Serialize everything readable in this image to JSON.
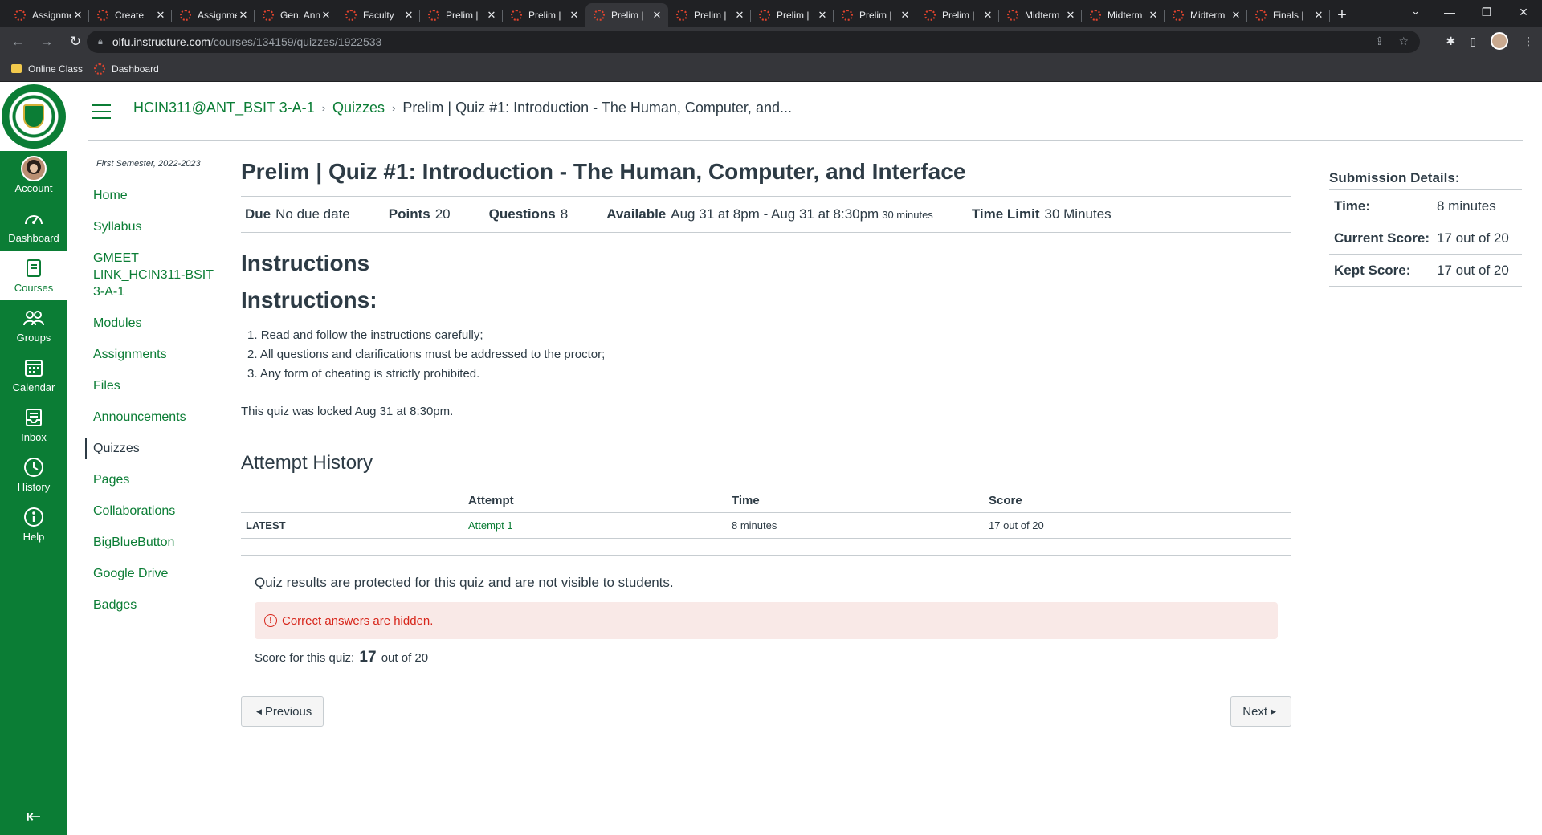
{
  "browser": {
    "tabs": [
      {
        "title": "Assignment",
        "active": false
      },
      {
        "title": "Create",
        "active": false
      },
      {
        "title": "Assignment",
        "active": false
      },
      {
        "title": "Gen. Announcements",
        "active": false
      },
      {
        "title": "Faculty",
        "active": false
      },
      {
        "title": "Prelim |",
        "active": false
      },
      {
        "title": "Prelim |",
        "active": false
      },
      {
        "title": "Prelim |",
        "active": true
      },
      {
        "title": "Prelim |",
        "active": false
      },
      {
        "title": "Prelim |",
        "active": false
      },
      {
        "title": "Prelim |",
        "active": false
      },
      {
        "title": "Prelim |",
        "active": false
      },
      {
        "title": "Midterm",
        "active": false
      },
      {
        "title": "Midterm",
        "active": false
      },
      {
        "title": "Midterm",
        "active": false
      },
      {
        "title": "Finals |",
        "active": false
      }
    ],
    "url_host": "olfu.instructure.com",
    "url_path": "/courses/134159/quizzes/1922533",
    "bookmarks": [
      "Online Class",
      "Dashboard"
    ]
  },
  "global_nav": [
    {
      "label": "Account",
      "icon": "avatar"
    },
    {
      "label": "Dashboard",
      "icon": "dashboard-icon"
    },
    {
      "label": "Courses",
      "icon": "courses-icon",
      "active": true
    },
    {
      "label": "Groups",
      "icon": "groups-icon"
    },
    {
      "label": "Calendar",
      "icon": "calendar-icon"
    },
    {
      "label": "Inbox",
      "icon": "inbox-icon"
    },
    {
      "label": "History",
      "icon": "history-icon"
    },
    {
      "label": "Help",
      "icon": "help-icon"
    }
  ],
  "breadcrumb": {
    "course": "HCIN311@ANT_BSIT 3-A-1",
    "section": "Quizzes",
    "current": "Prelim | Quiz #1: Introduction - The Human, Computer, and..."
  },
  "course_nav": {
    "term": "First Semester, 2022-2023",
    "items": [
      "Home",
      "Syllabus",
      "GMEET LINK_HCIN311-BSIT 3-A-1",
      "Modules",
      "Assignments",
      "Files",
      "Announcements",
      "Quizzes",
      "Pages",
      "Collaborations",
      "BigBlueButton",
      "Google Drive",
      "Badges"
    ],
    "active_item": "Quizzes"
  },
  "quiz": {
    "title": "Prelim | Quiz #1: Introduction - The Human, Computer, and Interface",
    "due_label": "Due",
    "due_value": "No due date",
    "points_label": "Points",
    "points_value": "20",
    "questions_label": "Questions",
    "questions_value": "8",
    "available_label": "Available",
    "available_value": "Aug 31 at 8pm - Aug 31 at 8:30pm",
    "available_duration": "30 minutes",
    "time_limit_label": "Time Limit",
    "time_limit_value": "30 Minutes",
    "instructions_heading": "Instructions",
    "instructions_subheading": "Instructions:",
    "instructions": [
      "Read and follow the instructions carefully;",
      "All questions and clarifications must be addressed to the proctor;",
      "Any form of cheating is strictly prohibited."
    ],
    "locked_note": "This quiz was locked Aug 31 at 8:30pm."
  },
  "attempt_history": {
    "heading": "Attempt History",
    "columns": [
      "",
      "Attempt",
      "Time",
      "Score"
    ],
    "rows": [
      {
        "tag": "LATEST",
        "attempt": "Attempt 1",
        "time": "8 minutes",
        "score": "17 out of 20"
      }
    ]
  },
  "results": {
    "protected_note": "Quiz results are protected for this quiz and are not visible to students.",
    "alert": "Correct answers are hidden.",
    "score_prefix": "Score for this quiz:",
    "score_value": "17",
    "score_suffix": "out of 20"
  },
  "pager": {
    "previous": "Previous",
    "next": "Next"
  },
  "submission": {
    "title": "Submission Details:",
    "time_label": "Time:",
    "time_value": "8 minutes",
    "current_label": "Current Score:",
    "current_value": "17 out of 20",
    "kept_label": "Kept Score:",
    "kept_value": "17 out of 20"
  },
  "colors": {
    "brand": "#0b7d35",
    "alert_bg": "#f9e9e7",
    "alert_text": "#d7261b"
  }
}
